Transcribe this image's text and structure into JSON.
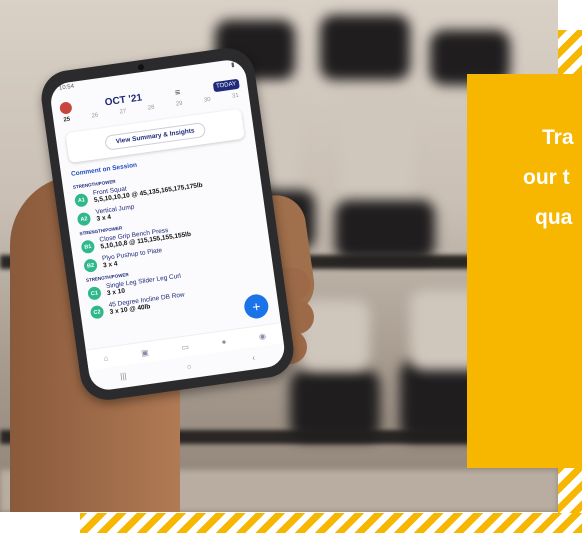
{
  "colors": {
    "accent_yellow": "#f7b600",
    "brand_navy": "#1f2a7a",
    "exercise_green": "#2fb88a",
    "fab_blue": "#1a73e8"
  },
  "phone_app": {
    "status_time": "10:54",
    "month_label": "OCT '21",
    "today_button": "TODAY",
    "dates": [
      "25",
      "26",
      "27",
      "28",
      "29",
      "30",
      "31"
    ],
    "summary_button": "View Summary & Insights",
    "comment_link": "Comment on Session",
    "sections": [
      {
        "label": "STRENGTH/POWER",
        "exercises": [
          {
            "badge": "A1",
            "name": "Front Squat",
            "detail": "5,5,10,10,10 @ 45,135,165,175,175lb"
          },
          {
            "badge": "A2",
            "name": "Vertical Jump",
            "detail": "3 x 4"
          }
        ]
      },
      {
        "label": "STRENGTH/POWER",
        "exercises": [
          {
            "badge": "B1",
            "name": "Close Grip Bench Press",
            "detail": "5,10,10,8 @ 115,155,155,155lb"
          },
          {
            "badge": "B2",
            "name": "Plyo Pushup to Plate",
            "detail": "3 x 4"
          }
        ]
      },
      {
        "label": "STRENGTH/POWER",
        "exercises": [
          {
            "badge": "C1",
            "name": "Single Leg Slider Leg Curl",
            "detail": "3 x 10"
          },
          {
            "badge": "C2",
            "name": "45 Degree Incline DB Row",
            "detail": "3 x 10 @ 40lb"
          }
        ]
      }
    ],
    "fab_label": "+",
    "nav_icons": [
      "home-icon",
      "calendar-icon",
      "chat-icon",
      "notification-icon",
      "profile-icon"
    ],
    "system_nav_icons": [
      "recents-icon",
      "home-circle-icon",
      "back-icon"
    ]
  },
  "card": {
    "lines": [
      "Tra",
      "our t",
      "qua"
    ]
  }
}
